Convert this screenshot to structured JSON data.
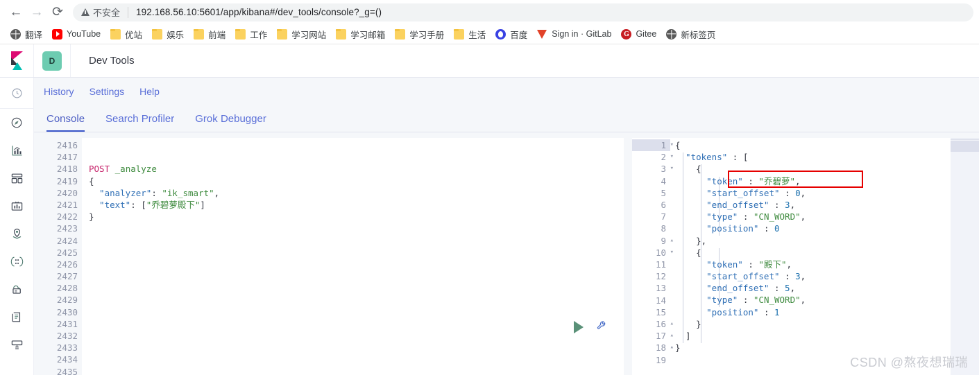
{
  "browser": {
    "back_icon": "arrow-left-icon",
    "forward_icon": "arrow-right-icon",
    "reload_icon": "reload-icon",
    "security_label": "不安全",
    "url": "192.168.56.10:5601/app/kibana#/dev_tools/console?_g=()",
    "bookmarks": [
      {
        "label": "翻译",
        "icon": "globe-icon"
      },
      {
        "label": "YouTube",
        "icon": "youtube-icon"
      },
      {
        "label": "优站",
        "icon": "folder-icon"
      },
      {
        "label": "娱乐",
        "icon": "folder-icon"
      },
      {
        "label": "前端",
        "icon": "folder-icon"
      },
      {
        "label": "工作",
        "icon": "folder-icon"
      },
      {
        "label": "学习网站",
        "icon": "folder-icon"
      },
      {
        "label": "学习邮箱",
        "icon": "folder-icon"
      },
      {
        "label": "学习手册",
        "icon": "folder-icon"
      },
      {
        "label": "生活",
        "icon": "folder-icon"
      },
      {
        "label": "百度",
        "icon": "baidu-icon"
      },
      {
        "label": "Sign in · GitLab",
        "icon": "gitlab-icon"
      },
      {
        "label": "Gitee",
        "icon": "gitee-icon"
      },
      {
        "label": "新标签页",
        "icon": "globe-icon"
      }
    ]
  },
  "kibana": {
    "logo": "kibana-logo",
    "app_badge": "D",
    "app_title": "Dev Tools",
    "menu": [
      {
        "label": "History"
      },
      {
        "label": "Settings"
      },
      {
        "label": "Help"
      }
    ],
    "tabs": [
      {
        "label": "Console",
        "active": true
      },
      {
        "label": "Search Profiler",
        "active": false
      },
      {
        "label": "Grok Debugger",
        "active": false
      }
    ],
    "sidenav": [
      {
        "icon": "clock-icon",
        "name": "recently-viewed"
      },
      {
        "icon": "compass-icon",
        "name": "discover"
      },
      {
        "icon": "bar-chart-icon",
        "name": "visualize"
      },
      {
        "icon": "dashboard-icon",
        "name": "dashboard"
      },
      {
        "icon": "canvas-icon",
        "name": "canvas"
      },
      {
        "icon": "map-marker-icon",
        "name": "maps"
      },
      {
        "icon": "machine-learning-icon",
        "name": "machine-learning"
      },
      {
        "icon": "infrastructure-icon",
        "name": "infrastructure"
      },
      {
        "icon": "logs-icon",
        "name": "logs"
      },
      {
        "icon": "apm-icon",
        "name": "apm"
      }
    ]
  },
  "editor": {
    "first_line_number": 2416,
    "line_count": 20,
    "fold_lines": {
      "2419": "open",
      "2422": "close"
    },
    "lines": [
      {
        "n": 2416,
        "tokens": []
      },
      {
        "n": 2417,
        "tokens": []
      },
      {
        "n": 2418,
        "tokens": [
          {
            "cls": "t-method",
            "text": "POST"
          },
          {
            "cls": "t-punc",
            "text": " "
          },
          {
            "cls": "t-url",
            "text": "_analyze"
          }
        ]
      },
      {
        "n": 2419,
        "tokens": [
          {
            "cls": "t-brace",
            "text": "{"
          }
        ]
      },
      {
        "n": 2420,
        "tokens": [
          {
            "cls": "t-key",
            "text": "  \"analyzer\""
          },
          {
            "cls": "t-punc",
            "text": ": "
          },
          {
            "cls": "t-str",
            "text": "\"ik_smart\""
          },
          {
            "cls": "t-punc",
            "text": ","
          }
        ]
      },
      {
        "n": 2421,
        "tokens": [
          {
            "cls": "t-key",
            "text": "  \"text\""
          },
          {
            "cls": "t-punc",
            "text": ": ["
          },
          {
            "cls": "t-str",
            "text": "\"乔碧萝殿下\""
          },
          {
            "cls": "t-punc",
            "text": "]"
          }
        ]
      },
      {
        "n": 2422,
        "tokens": [
          {
            "cls": "t-brace",
            "text": "}"
          }
        ]
      },
      {
        "n": 2423,
        "tokens": []
      },
      {
        "n": 2424,
        "tokens": []
      },
      {
        "n": 2425,
        "tokens": []
      },
      {
        "n": 2426,
        "tokens": []
      },
      {
        "n": 2427,
        "tokens": []
      },
      {
        "n": 2428,
        "tokens": []
      },
      {
        "n": 2429,
        "tokens": []
      },
      {
        "n": 2430,
        "tokens": []
      },
      {
        "n": 2431,
        "tokens": []
      },
      {
        "n": 2432,
        "tokens": []
      },
      {
        "n": 2433,
        "tokens": []
      },
      {
        "n": 2434,
        "tokens": []
      },
      {
        "n": 2435,
        "tokens": []
      }
    ],
    "run_button": "play-icon",
    "wrench_button": "wrench-icon"
  },
  "response": {
    "active_line": 1,
    "highlight_color": "#e60000",
    "fold_lines": {
      "1": "open",
      "2": "open",
      "3": "open",
      "9": "close",
      "10": "open",
      "16": "close",
      "17": "close",
      "18": "close"
    },
    "lines": [
      {
        "n": 1,
        "tokens": [
          {
            "cls": "t-brace",
            "text": "{"
          }
        ]
      },
      {
        "n": 2,
        "tokens": [
          {
            "cls": "t-key",
            "text": "  \"tokens\""
          },
          {
            "cls": "t-punc",
            "text": " : ["
          }
        ]
      },
      {
        "n": 3,
        "tokens": [
          {
            "cls": "t-brace",
            "text": "    {"
          }
        ]
      },
      {
        "n": 4,
        "tokens": [
          {
            "cls": "t-key",
            "text": "      \"token\""
          },
          {
            "cls": "t-punc",
            "text": " : "
          },
          {
            "cls": "t-str",
            "text": "\"乔碧萝\""
          },
          {
            "cls": "t-punc",
            "text": ","
          }
        ]
      },
      {
        "n": 5,
        "tokens": [
          {
            "cls": "t-key",
            "text": "      \"start_offset\""
          },
          {
            "cls": "t-punc",
            "text": " : "
          },
          {
            "cls": "t-num",
            "text": "0"
          },
          {
            "cls": "t-punc",
            "text": ","
          }
        ]
      },
      {
        "n": 6,
        "tokens": [
          {
            "cls": "t-key",
            "text": "      \"end_offset\""
          },
          {
            "cls": "t-punc",
            "text": " : "
          },
          {
            "cls": "t-num",
            "text": "3"
          },
          {
            "cls": "t-punc",
            "text": ","
          }
        ]
      },
      {
        "n": 7,
        "tokens": [
          {
            "cls": "t-key",
            "text": "      \"type\""
          },
          {
            "cls": "t-punc",
            "text": " : "
          },
          {
            "cls": "t-str",
            "text": "\"CN_WORD\""
          },
          {
            "cls": "t-punc",
            "text": ","
          }
        ]
      },
      {
        "n": 8,
        "tokens": [
          {
            "cls": "t-key",
            "text": "      \"position\""
          },
          {
            "cls": "t-punc",
            "text": " : "
          },
          {
            "cls": "t-num",
            "text": "0"
          }
        ]
      },
      {
        "n": 9,
        "tokens": [
          {
            "cls": "t-brace",
            "text": "    },"
          }
        ]
      },
      {
        "n": 10,
        "tokens": [
          {
            "cls": "t-brace",
            "text": "    {"
          }
        ]
      },
      {
        "n": 11,
        "tokens": [
          {
            "cls": "t-key",
            "text": "      \"token\""
          },
          {
            "cls": "t-punc",
            "text": " : "
          },
          {
            "cls": "t-str",
            "text": "\"殿下\""
          },
          {
            "cls": "t-punc",
            "text": ","
          }
        ]
      },
      {
        "n": 12,
        "tokens": [
          {
            "cls": "t-key",
            "text": "      \"start_offset\""
          },
          {
            "cls": "t-punc",
            "text": " : "
          },
          {
            "cls": "t-num",
            "text": "3"
          },
          {
            "cls": "t-punc",
            "text": ","
          }
        ]
      },
      {
        "n": 13,
        "tokens": [
          {
            "cls": "t-key",
            "text": "      \"end_offset\""
          },
          {
            "cls": "t-punc",
            "text": " : "
          },
          {
            "cls": "t-num",
            "text": "5"
          },
          {
            "cls": "t-punc",
            "text": ","
          }
        ]
      },
      {
        "n": 14,
        "tokens": [
          {
            "cls": "t-key",
            "text": "      \"type\""
          },
          {
            "cls": "t-punc",
            "text": " : "
          },
          {
            "cls": "t-str",
            "text": "\"CN_WORD\""
          },
          {
            "cls": "t-punc",
            "text": ","
          }
        ]
      },
      {
        "n": 15,
        "tokens": [
          {
            "cls": "t-key",
            "text": "      \"position\""
          },
          {
            "cls": "t-punc",
            "text": " : "
          },
          {
            "cls": "t-num",
            "text": "1"
          }
        ]
      },
      {
        "n": 16,
        "tokens": [
          {
            "cls": "t-brace",
            "text": "    }"
          }
        ]
      },
      {
        "n": 17,
        "tokens": [
          {
            "cls": "t-brace",
            "text": "  ]"
          }
        ]
      },
      {
        "n": 18,
        "tokens": [
          {
            "cls": "t-brace",
            "text": "}"
          }
        ]
      },
      {
        "n": 19,
        "tokens": []
      }
    ]
  },
  "watermark": {
    "text": "CSDN @熬夜想瑞瑞"
  }
}
